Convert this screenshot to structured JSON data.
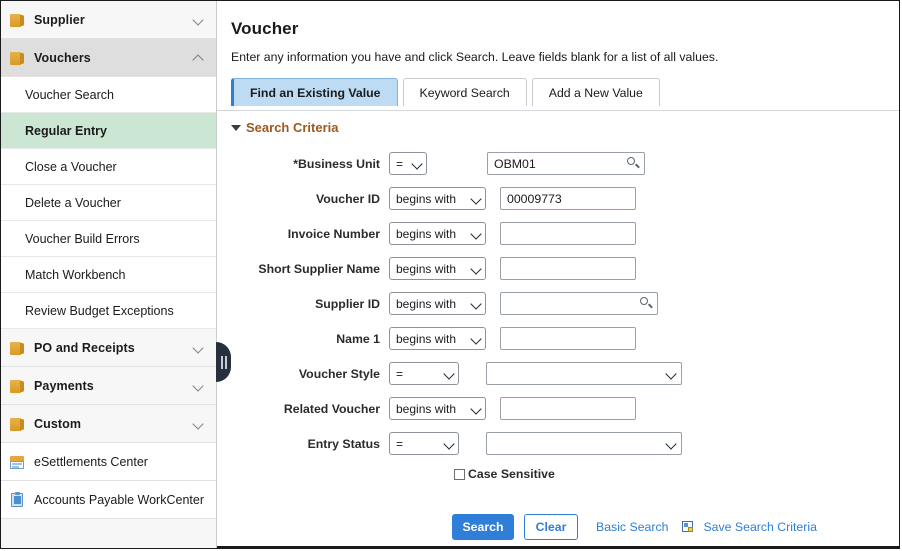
{
  "sidebar": {
    "groups": [
      {
        "label": "Supplier",
        "icon": "folder-icon",
        "state": "collapsed",
        "chevron": "chevron-down-icon"
      },
      {
        "label": "Vouchers",
        "icon": "folder-icon",
        "state": "expanded",
        "chevron": "chevron-up-icon"
      },
      {
        "label": "PO and Receipts",
        "icon": "folder-icon",
        "state": "collapsed",
        "chevron": "chevron-down-icon"
      },
      {
        "label": "Payments",
        "icon": "folder-icon",
        "state": "collapsed",
        "chevron": "chevron-down-icon"
      },
      {
        "label": "Custom",
        "icon": "folder-icon",
        "state": "collapsed",
        "chevron": "chevron-down-icon"
      }
    ],
    "voucher_items": [
      {
        "label": "Voucher Search",
        "selected": false
      },
      {
        "label": "Regular Entry",
        "selected": true
      },
      {
        "label": "Close a Voucher",
        "selected": false
      },
      {
        "label": "Delete a Voucher",
        "selected": false
      },
      {
        "label": "Voucher Build Errors",
        "selected": false
      },
      {
        "label": "Match Workbench",
        "selected": false
      },
      {
        "label": "Review Budget Exceptions",
        "selected": false
      }
    ],
    "links": [
      {
        "label": "eSettlements Center",
        "icon": "window-icon"
      },
      {
        "label": "Accounts Payable WorkCenter",
        "icon": "clipboard-icon"
      }
    ],
    "selected_color": "#cbe7d4",
    "collapse_handle": "collapse-sidebar-handle"
  },
  "main": {
    "title": "Voucher",
    "subtitle": "Enter any information you have and click Search. Leave fields blank for a list of all values.",
    "tabs": [
      {
        "label": "Find an Existing Value",
        "accesskey": "F",
        "active": true
      },
      {
        "label": "Keyword Search",
        "accesskey": "K",
        "active": false
      },
      {
        "label": "Add a New Value",
        "accesskey": "A",
        "active": false
      }
    ],
    "section": {
      "title": "Search Criteria",
      "expanded": true,
      "color": "#9c5a1e"
    },
    "fields": [
      {
        "label": "*Business Unit",
        "operator": "=",
        "op_width": "narrow",
        "value": "OBM01",
        "control": "lookup",
        "input_width": 158
      },
      {
        "label": "Voucher ID",
        "operator": "begins with",
        "op_width": "bw",
        "value": "00009773",
        "control": "text",
        "input_width": 136
      },
      {
        "label": "Invoice Number",
        "operator": "begins with",
        "op_width": "bw",
        "value": "",
        "control": "text",
        "input_width": 136
      },
      {
        "label": "Short Supplier Name",
        "operator": "begins with",
        "op_width": "bw",
        "value": "",
        "control": "text",
        "input_width": 136
      },
      {
        "label": "Supplier ID",
        "operator": "begins with",
        "op_width": "bw",
        "value": "",
        "control": "lookup",
        "input_width": 158
      },
      {
        "label": "Name 1",
        "operator": "begins with",
        "op_width": "bw",
        "value": "",
        "control": "text",
        "input_width": 136
      },
      {
        "label": "Voucher Style",
        "operator": "=",
        "op_width": "wide",
        "value": "",
        "control": "select",
        "input_width": 196
      },
      {
        "label": "Related Voucher",
        "operator": "begins with",
        "op_width": "bw",
        "value": "",
        "control": "text",
        "input_width": 136
      },
      {
        "label": "Entry Status",
        "operator": "=",
        "op_width": "wide",
        "value": "",
        "control": "select",
        "input_width": 196
      }
    ],
    "case_sensitive": {
      "label": "Case Sensitive",
      "checked": false
    },
    "actions": {
      "search_label": "Search",
      "clear_label": "Clear",
      "basic_search_label": "Basic Search",
      "save_criteria_label": "Save Search Criteria",
      "save_icon": "save-search-icon",
      "primary_color": "#2f7ed8"
    }
  }
}
